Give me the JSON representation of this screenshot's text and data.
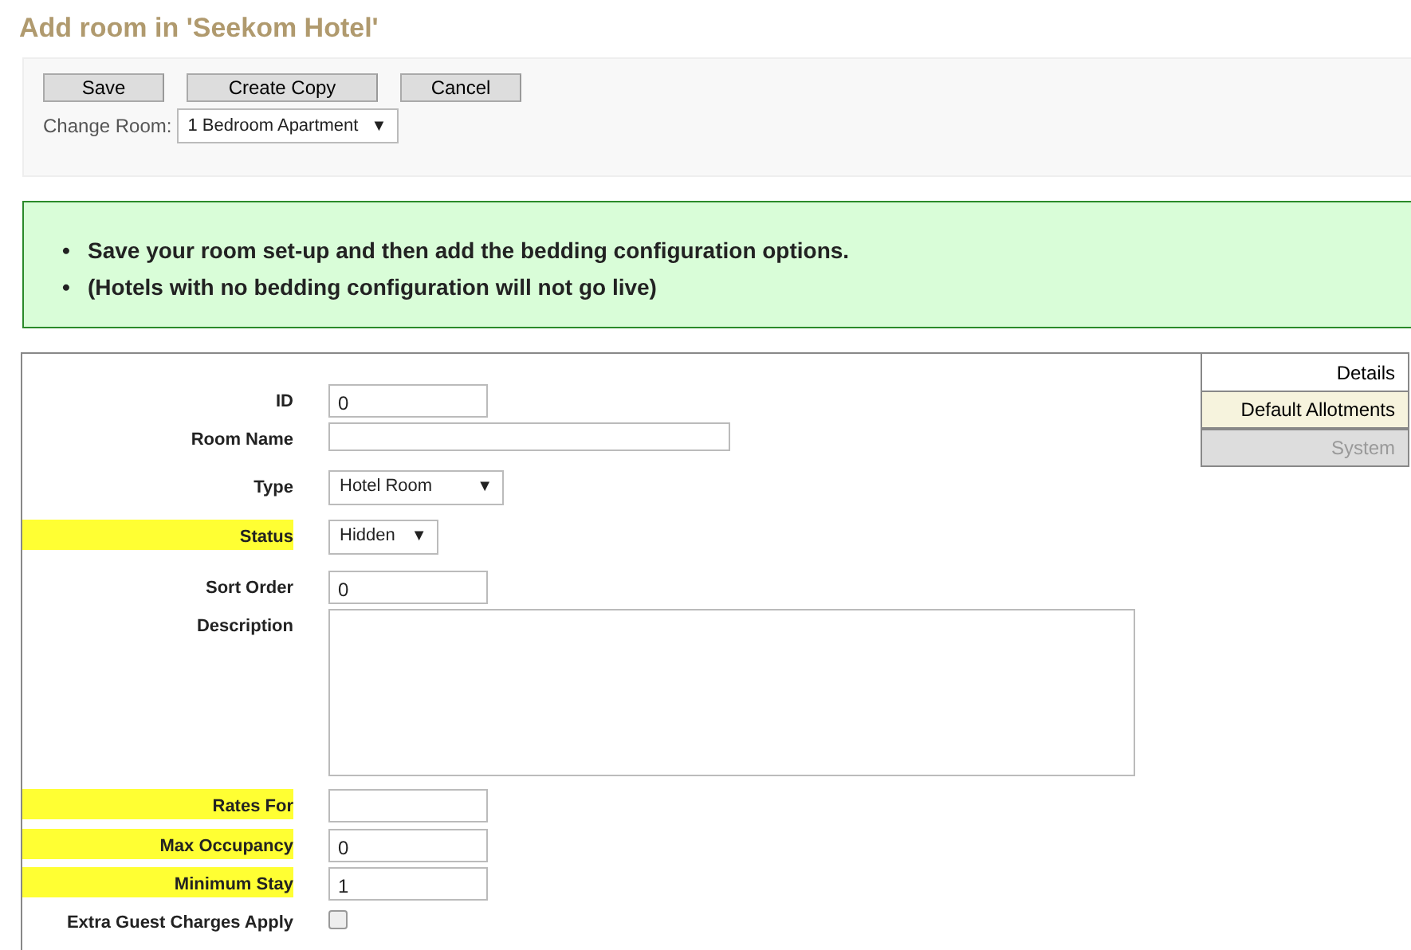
{
  "title": "Add room in 'Seekom Hotel'",
  "toolbar": {
    "buttons": [
      "Save",
      "Create Copy",
      "Cancel"
    ],
    "change_room": {
      "label": "Change Room:",
      "value": "1 Bedroom Apartment",
      "arrow": "▼"
    }
  },
  "notice": [
    {
      "bullet": "•",
      "text": "Save your room set-up and then add the bedding configuration options."
    },
    {
      "bullet": "•",
      "text": "(Hotels with no bedding configuration will not go live)"
    }
  ],
  "tabs": [
    {
      "label": "Details",
      "selected": true,
      "disabled": false
    },
    {
      "label": "Default Allotments",
      "selected": false,
      "disabled": false
    },
    {
      "label": "System",
      "selected": false,
      "disabled": true
    }
  ],
  "fields": [
    {
      "label": "ID",
      "kind": "text",
      "value": "0",
      "highlighted": false
    },
    {
      "label": "Room Name",
      "kind": "wide",
      "highlighted": false
    },
    {
      "label": "Type",
      "kind": "select",
      "value": "Hotel Room",
      "arrow": "▼",
      "highlighted": false
    },
    {
      "label": "Status",
      "kind": "select",
      "value": "Hidden",
      "arrow": "▼",
      "highlighted": true
    },
    {
      "label": "Sort Order",
      "kind": "text",
      "value": "0",
      "highlighted": false
    },
    {
      "label": "Description",
      "kind": "textarea",
      "highlighted": false
    },
    {
      "label": "Rates For",
      "kind": "text",
      "highlighted": true
    },
    {
      "label": "Max Occupancy",
      "kind": "text",
      "value": "0",
      "highlighted": true
    },
    {
      "label": "Minimum Stay",
      "kind": "text",
      "value": "1",
      "highlighted": true
    },
    {
      "label": "Extra Guest Charges Apply",
      "kind": "checkbox",
      "checked": false,
      "highlighted": false
    }
  ]
}
